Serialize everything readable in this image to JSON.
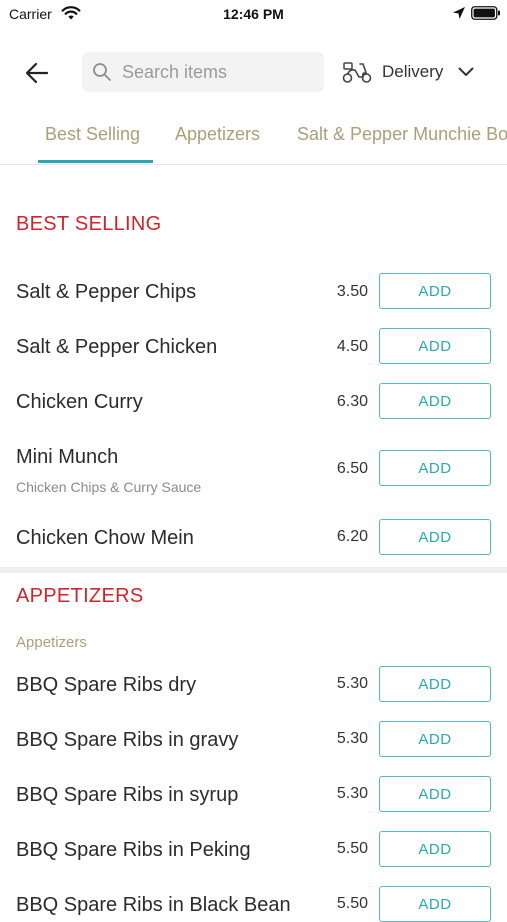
{
  "status_bar": {
    "carrier": "Carrier",
    "time": "12:46 PM"
  },
  "header": {
    "search_placeholder": "Search items",
    "delivery_label": "Delivery"
  },
  "tabs": [
    {
      "label": "Best Selling",
      "active": true
    },
    {
      "label": "Appetizers",
      "active": false
    },
    {
      "label": "Salt & Pepper Munchie Box",
      "active": false
    }
  ],
  "colors": {
    "accent": "#2aa8b2",
    "section_title": "#d2232a",
    "tab_text": "#ab9f7a"
  },
  "best_selling": {
    "title": "BEST SELLING",
    "items": [
      {
        "name": "Salt & Pepper Chips",
        "desc": "",
        "price": "3.50",
        "button": "ADD"
      },
      {
        "name": "Salt & Pepper Chicken",
        "desc": "",
        "price": "4.50",
        "button": "ADD"
      },
      {
        "name": "Chicken Curry",
        "desc": "",
        "price": "6.30",
        "button": "ADD"
      },
      {
        "name": "Mini Munch",
        "desc": "Chicken Chips & Curry Sauce",
        "price": "6.50",
        "button": "ADD"
      },
      {
        "name": "Chicken Chow Mein",
        "desc": "",
        "price": "6.20",
        "button": "ADD"
      }
    ]
  },
  "appetizers": {
    "title": "APPETIZERS",
    "subtitle": "Appetizers",
    "items": [
      {
        "name": "BBQ Spare Ribs dry",
        "price": "5.30",
        "button": "ADD"
      },
      {
        "name": "BBQ Spare Ribs in gravy",
        "price": "5.30",
        "button": "ADD"
      },
      {
        "name": "BBQ Spare Ribs in syrup",
        "price": "5.30",
        "button": "ADD"
      },
      {
        "name": "BBQ Spare Ribs in Peking",
        "price": "5.50",
        "button": "ADD"
      },
      {
        "name": "BBQ Spare Ribs in Black Bean",
        "price": "5.50",
        "button": "ADD"
      }
    ]
  }
}
